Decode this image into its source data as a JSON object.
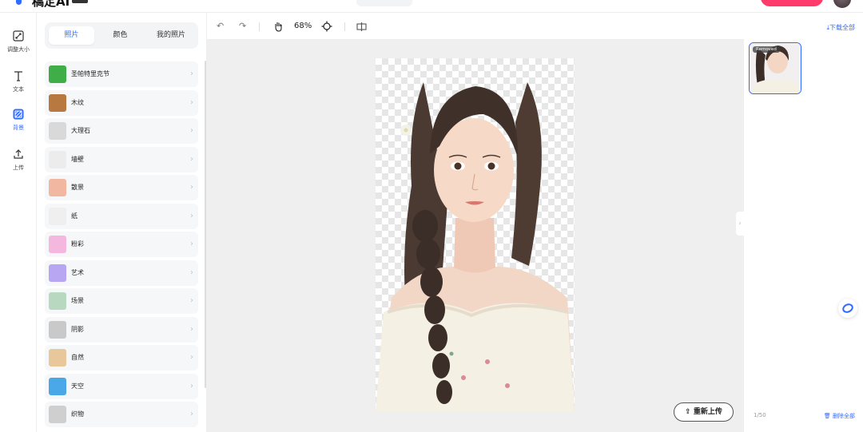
{
  "header": {
    "logo_text": "稿定AI"
  },
  "rail": {
    "items": [
      {
        "label": "调整大小",
        "icon": "resize-icon"
      },
      {
        "label": "文本",
        "icon": "text-icon"
      },
      {
        "label": "背景",
        "icon": "background-icon",
        "active": true
      },
      {
        "label": "上传",
        "icon": "upload-icon"
      }
    ]
  },
  "panel": {
    "tabs": [
      {
        "label": "照片",
        "active": true
      },
      {
        "label": "颜色"
      },
      {
        "label": "我的照片"
      }
    ],
    "categories": [
      {
        "label": "圣帕特里克节",
        "color": "#3fae49"
      },
      {
        "label": "木纹",
        "color": "#b7793f"
      },
      {
        "label": "大理石",
        "color": "#d9d9d9"
      },
      {
        "label": "墙壁",
        "color": "#ececec"
      },
      {
        "label": "散景",
        "color": "#f2b7a0"
      },
      {
        "label": "纸",
        "color": "#efefef"
      },
      {
        "label": "粉彩",
        "color": "#f4b8de"
      },
      {
        "label": "艺术",
        "color": "#b9a6f2"
      },
      {
        "label": "场景",
        "color": "#b9d8c0"
      },
      {
        "label": "阴影",
        "color": "#c9c9c9"
      },
      {
        "label": "自然",
        "color": "#e8c89b"
      },
      {
        "label": "天空",
        "color": "#4aa8e8"
      },
      {
        "label": "织物",
        "color": "#cfcfcf"
      }
    ]
  },
  "toolbar": {
    "zoom": "68%"
  },
  "canvas": {
    "reupload_label": "重新上传"
  },
  "right": {
    "download_all": "下载全部",
    "badge": "Removed",
    "count": "1/50",
    "delete_all": "删除全部"
  },
  "colors": {
    "accent": "#2f6bff",
    "cta": "#ff3b6b"
  }
}
